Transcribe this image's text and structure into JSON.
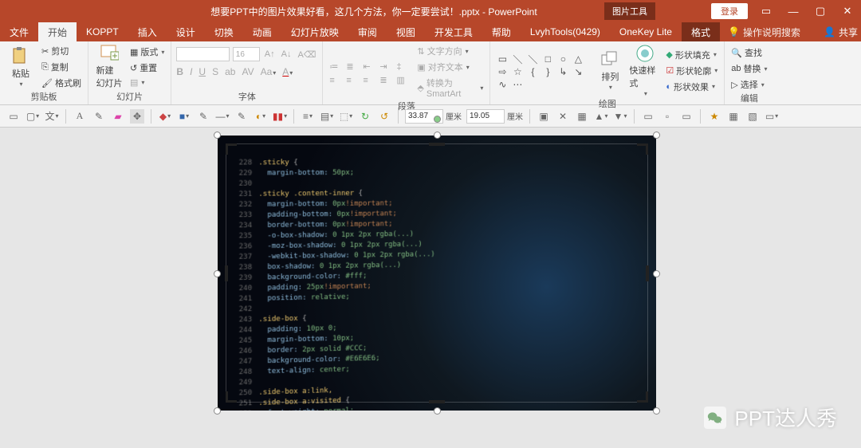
{
  "title": "想要PPT中的图片效果好看，这几个方法，你一定要尝试！.pptx - PowerPoint",
  "tooltab": "图片工具",
  "login": "登录",
  "tabs": {
    "file": "文件",
    "home": "开始",
    "koppt": "KOPPT",
    "insert": "插入",
    "design": "设计",
    "transitions": "切换",
    "animations": "动画",
    "slideshow": "幻灯片放映",
    "review": "审阅",
    "view": "视图",
    "developer": "开发工具",
    "help": "帮助",
    "lvyh": "LvyhTools(0429)",
    "onekey": "OneKey Lite",
    "format": "格式"
  },
  "tell_me": "操作说明搜索",
  "share": "共享",
  "ribbon": {
    "clipboard": {
      "paste": "粘贴",
      "cut": "剪切",
      "copy": "复制",
      "painter": "格式刷",
      "label": "剪贴板"
    },
    "slides": {
      "new": "新建\n幻灯片",
      "layout": "版式",
      "reset": "重置",
      "label": "幻灯片"
    },
    "font": {
      "size": "16",
      "label": "字体"
    },
    "paragraph": {
      "direction": "文字方向",
      "align": "对齐文本",
      "smartart": "转换为 SmartArt",
      "label": "段落"
    },
    "drawing": {
      "arrange": "排列",
      "quick": "快速样式",
      "fill": "形状填充",
      "outline": "形状轮廓",
      "effects": "形状效果",
      "label": "绘图"
    },
    "editing": {
      "find": "查找",
      "replace": "替换",
      "select": "选择",
      "label": "编辑"
    }
  },
  "dims": {
    "h": "33.87",
    "w": "19.05",
    "unit": "厘米"
  },
  "watermark": "PPT达人秀"
}
